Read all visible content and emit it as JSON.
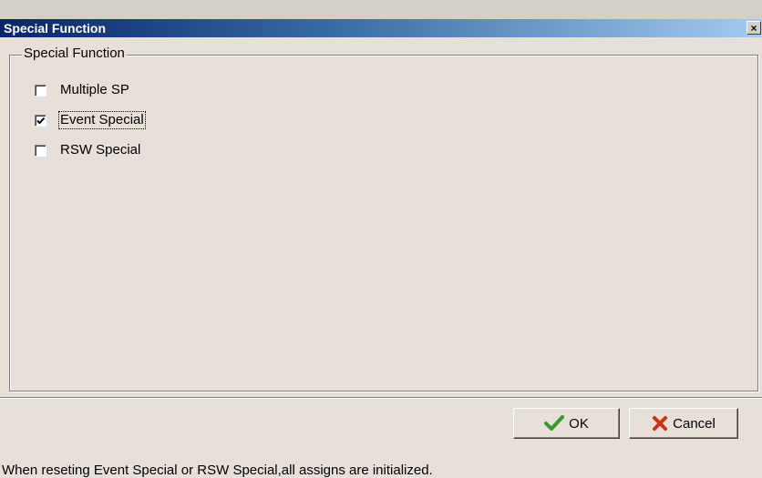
{
  "window": {
    "title": "Special Function",
    "close_symbol": "×"
  },
  "group": {
    "legend": "Special Function",
    "options": [
      {
        "label": "Multiple SP",
        "checked": false
      },
      {
        "label": "Event Special",
        "checked": true
      },
      {
        "label": "RSW Special",
        "checked": false
      }
    ]
  },
  "buttons": {
    "ok_label": "OK",
    "cancel_label": "Cancel",
    "ok_icon": "checkmark-icon",
    "cancel_icon": "x-mark-icon"
  },
  "status": {
    "text": "When reseting Event Special or RSW Special,all assigns are initialized."
  },
  "colors": {
    "titlebar_start": "#0a246a",
    "titlebar_end": "#a6caf0",
    "ok_icon": "#3a9a2a",
    "cancel_icon": "#d03010"
  }
}
